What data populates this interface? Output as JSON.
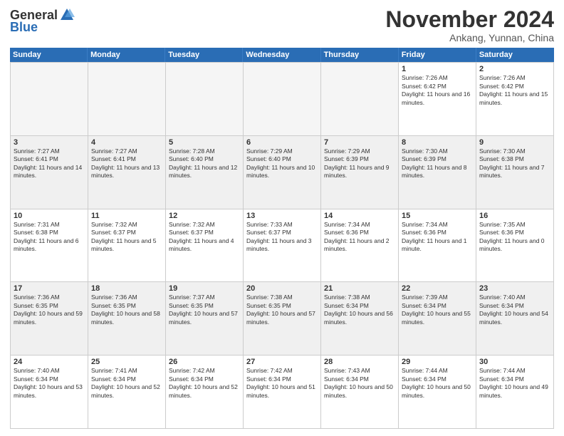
{
  "logo": {
    "general": "General",
    "blue": "Blue",
    "tagline": ""
  },
  "header": {
    "month_title": "November 2024",
    "location": "Ankang, Yunnan, China"
  },
  "weekdays": [
    "Sunday",
    "Monday",
    "Tuesday",
    "Wednesday",
    "Thursday",
    "Friday",
    "Saturday"
  ],
  "weeks": [
    [
      {
        "day": "",
        "empty": true
      },
      {
        "day": "",
        "empty": true
      },
      {
        "day": "",
        "empty": true
      },
      {
        "day": "",
        "empty": true
      },
      {
        "day": "",
        "empty": true
      },
      {
        "day": "1",
        "sunrise": "7:26 AM",
        "sunset": "6:42 PM",
        "daylight": "11 hours and 16 minutes."
      },
      {
        "day": "2",
        "sunrise": "7:26 AM",
        "sunset": "6:42 PM",
        "daylight": "11 hours and 15 minutes."
      }
    ],
    [
      {
        "day": "3",
        "sunrise": "7:27 AM",
        "sunset": "6:41 PM",
        "daylight": "11 hours and 14 minutes."
      },
      {
        "day": "4",
        "sunrise": "7:27 AM",
        "sunset": "6:41 PM",
        "daylight": "11 hours and 13 minutes."
      },
      {
        "day": "5",
        "sunrise": "7:28 AM",
        "sunset": "6:40 PM",
        "daylight": "11 hours and 12 minutes."
      },
      {
        "day": "6",
        "sunrise": "7:29 AM",
        "sunset": "6:40 PM",
        "daylight": "11 hours and 10 minutes."
      },
      {
        "day": "7",
        "sunrise": "7:29 AM",
        "sunset": "6:39 PM",
        "daylight": "11 hours and 9 minutes."
      },
      {
        "day": "8",
        "sunrise": "7:30 AM",
        "sunset": "6:39 PM",
        "daylight": "11 hours and 8 minutes."
      },
      {
        "day": "9",
        "sunrise": "7:30 AM",
        "sunset": "6:38 PM",
        "daylight": "11 hours and 7 minutes."
      }
    ],
    [
      {
        "day": "10",
        "sunrise": "7:31 AM",
        "sunset": "6:38 PM",
        "daylight": "11 hours and 6 minutes."
      },
      {
        "day": "11",
        "sunrise": "7:32 AM",
        "sunset": "6:37 PM",
        "daylight": "11 hours and 5 minutes."
      },
      {
        "day": "12",
        "sunrise": "7:32 AM",
        "sunset": "6:37 PM",
        "daylight": "11 hours and 4 minutes."
      },
      {
        "day": "13",
        "sunrise": "7:33 AM",
        "sunset": "6:37 PM",
        "daylight": "11 hours and 3 minutes."
      },
      {
        "day": "14",
        "sunrise": "7:34 AM",
        "sunset": "6:36 PM",
        "daylight": "11 hours and 2 minutes."
      },
      {
        "day": "15",
        "sunrise": "7:34 AM",
        "sunset": "6:36 PM",
        "daylight": "11 hours and 1 minute."
      },
      {
        "day": "16",
        "sunrise": "7:35 AM",
        "sunset": "6:36 PM",
        "daylight": "11 hours and 0 minutes."
      }
    ],
    [
      {
        "day": "17",
        "sunrise": "7:36 AM",
        "sunset": "6:35 PM",
        "daylight": "10 hours and 59 minutes."
      },
      {
        "day": "18",
        "sunrise": "7:36 AM",
        "sunset": "6:35 PM",
        "daylight": "10 hours and 58 minutes."
      },
      {
        "day": "19",
        "sunrise": "7:37 AM",
        "sunset": "6:35 PM",
        "daylight": "10 hours and 57 minutes."
      },
      {
        "day": "20",
        "sunrise": "7:38 AM",
        "sunset": "6:35 PM",
        "daylight": "10 hours and 57 minutes."
      },
      {
        "day": "21",
        "sunrise": "7:38 AM",
        "sunset": "6:34 PM",
        "daylight": "10 hours and 56 minutes."
      },
      {
        "day": "22",
        "sunrise": "7:39 AM",
        "sunset": "6:34 PM",
        "daylight": "10 hours and 55 minutes."
      },
      {
        "day": "23",
        "sunrise": "7:40 AM",
        "sunset": "6:34 PM",
        "daylight": "10 hours and 54 minutes."
      }
    ],
    [
      {
        "day": "24",
        "sunrise": "7:40 AM",
        "sunset": "6:34 PM",
        "daylight": "10 hours and 53 minutes."
      },
      {
        "day": "25",
        "sunrise": "7:41 AM",
        "sunset": "6:34 PM",
        "daylight": "10 hours and 52 minutes."
      },
      {
        "day": "26",
        "sunrise": "7:42 AM",
        "sunset": "6:34 PM",
        "daylight": "10 hours and 52 minutes."
      },
      {
        "day": "27",
        "sunrise": "7:42 AM",
        "sunset": "6:34 PM",
        "daylight": "10 hours and 51 minutes."
      },
      {
        "day": "28",
        "sunrise": "7:43 AM",
        "sunset": "6:34 PM",
        "daylight": "10 hours and 50 minutes."
      },
      {
        "day": "29",
        "sunrise": "7:44 AM",
        "sunset": "6:34 PM",
        "daylight": "10 hours and 50 minutes."
      },
      {
        "day": "30",
        "sunrise": "7:44 AM",
        "sunset": "6:34 PM",
        "daylight": "10 hours and 49 minutes."
      }
    ]
  ]
}
